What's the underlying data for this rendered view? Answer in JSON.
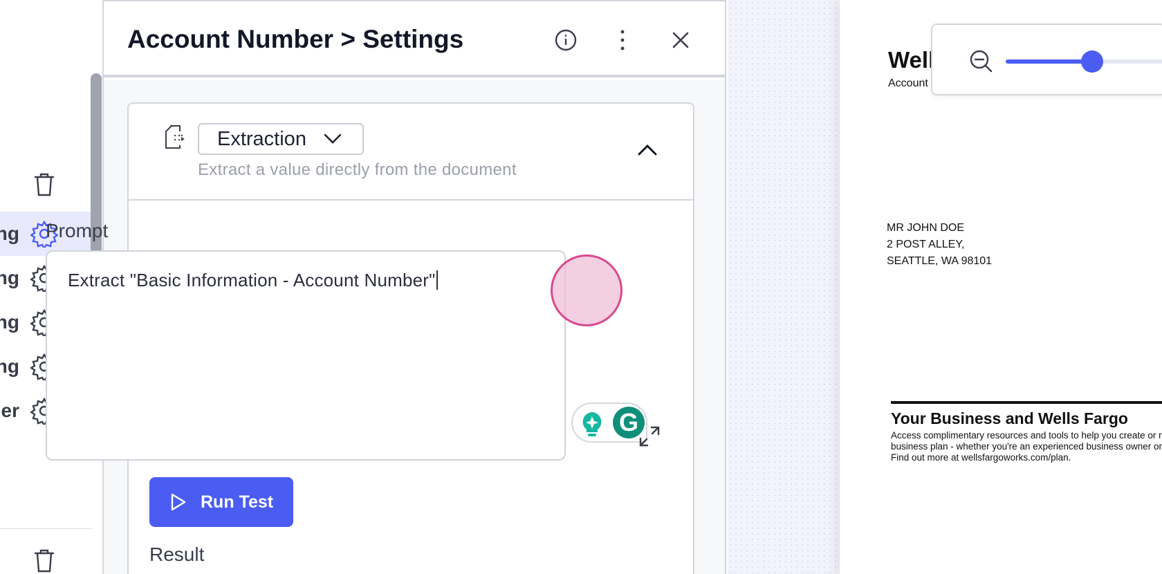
{
  "left_list": {
    "items": [
      {
        "label": "ng",
        "active": true
      },
      {
        "label": "ng",
        "active": false
      },
      {
        "label": "ng",
        "active": false
      },
      {
        "label": "ng",
        "active": false
      },
      {
        "label": "er",
        "active": false
      }
    ]
  },
  "panel": {
    "title": "Account Number > Settings",
    "icons": [
      "info-icon",
      "more-vertical-icon",
      "close-icon"
    ]
  },
  "card": {
    "mode": "Extraction",
    "mode_description": "Extract a value directly from the document",
    "prompt_label": "Prompt",
    "prompt_text": "Extract \"Basic Information - Account Number\"",
    "run_button": "Run Test",
    "result_label": "Result"
  },
  "document": {
    "title": "Well",
    "subtitle": "Account",
    "address": [
      "MR JOHN DOE",
      "2 POST ALLEY,",
      "SEATTLE, WA 98101"
    ],
    "business_title": "Your Business and Wells Fargo",
    "business_text": [
      "Access complimentary resources and tools to help you create or rev",
      "business plan - whether you're an experienced business owner or ju",
      "Find out more at wellsfargoworks.com/plan."
    ]
  },
  "zoom": {
    "level": 0.48
  },
  "colors": {
    "accent": "#4b5cf3",
    "active_row": "#e8e9fd",
    "click_marker": "#d84a8e",
    "grammarly": "#0f8f79"
  }
}
